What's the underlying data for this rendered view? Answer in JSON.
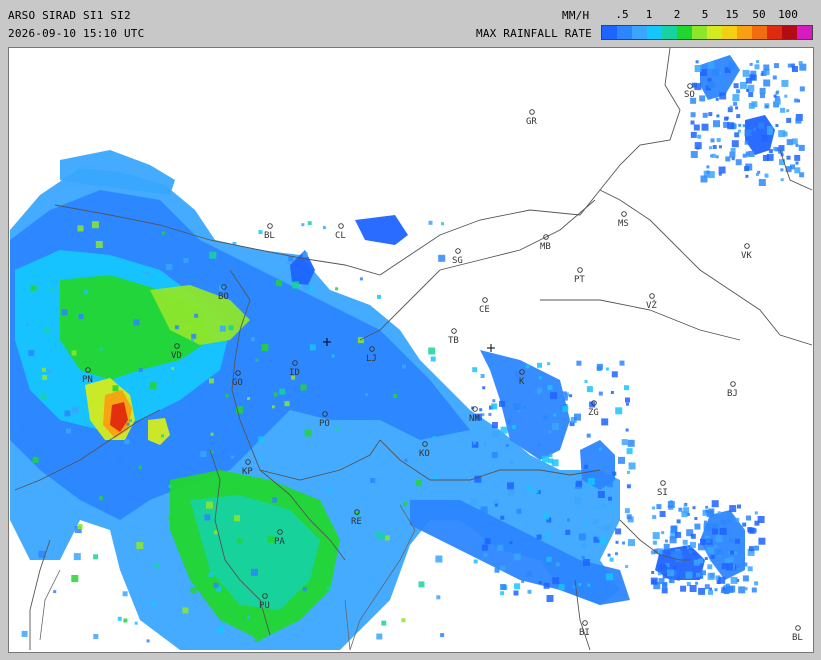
{
  "header": {
    "title": "ARSO SIRAD SI1 SI2",
    "timestamp": "2026-09-10 15:10 UTC",
    "units_label": "MM/H",
    "legend_label": "MAX RAINFALL RATE"
  },
  "legend": {
    "ticks": [
      ".5",
      "1",
      "2",
      "5",
      "15",
      "50",
      "100"
    ],
    "colors": [
      "#1e64ff",
      "#2c86ff",
      "#3aa6ff",
      "#16c6ff",
      "#18d2a0",
      "#22d630",
      "#8ee62c",
      "#d4ec1e",
      "#f4d012",
      "#f8a010",
      "#f26c10",
      "#e02a10",
      "#b40c14",
      "#d41cc0"
    ]
  },
  "map": {
    "background": "#ffffff",
    "border_color": "#707070",
    "cities": [
      {
        "code": "SO"
      },
      {
        "code": "GR"
      },
      {
        "code": "MS"
      },
      {
        "code": "MB"
      },
      {
        "code": "VK"
      },
      {
        "code": "SG"
      },
      {
        "code": "PT"
      },
      {
        "code": "CE"
      },
      {
        "code": "VŽ"
      },
      {
        "code": "TB"
      },
      {
        "code": "BJ"
      },
      {
        "code": "ZG"
      },
      {
        "code": "NM"
      },
      {
        "code": "SI"
      },
      {
        "code": "BI"
      },
      {
        "code": "BL"
      },
      {
        "code": "CL"
      },
      {
        "code": "BL"
      },
      {
        "code": "BO"
      },
      {
        "code": "VD"
      },
      {
        "code": "PN"
      },
      {
        "code": "ID"
      },
      {
        "code": "LJ"
      },
      {
        "code": "GO"
      },
      {
        "code": "PO"
      },
      {
        "code": "KO"
      },
      {
        "code": "KP"
      },
      {
        "code": "RE"
      },
      {
        "code": "PA"
      },
      {
        "code": "PU"
      },
      {
        "code": "K"
      }
    ]
  }
}
